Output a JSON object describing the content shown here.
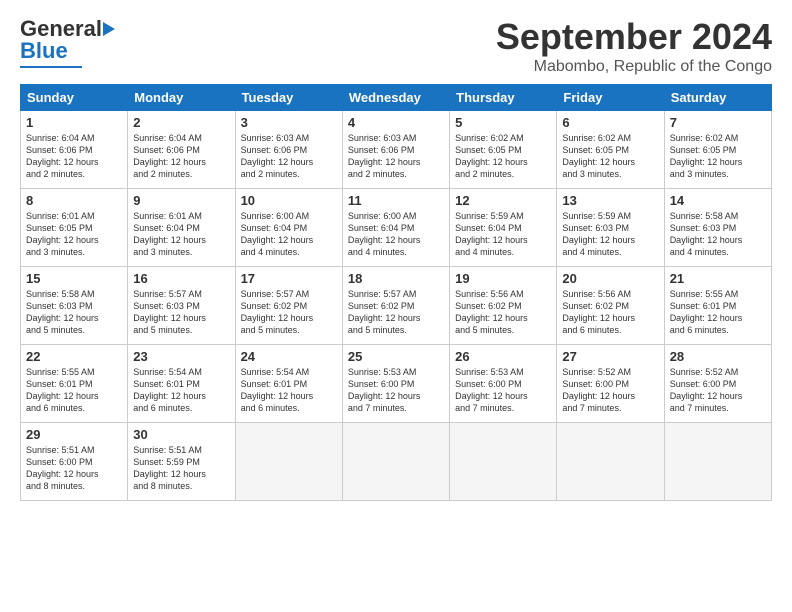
{
  "logo": {
    "text1": "General",
    "text2": "Blue"
  },
  "title": "September 2024",
  "subtitle": "Mabombo, Republic of the Congo",
  "days_of_week": [
    "Sunday",
    "Monday",
    "Tuesday",
    "Wednesday",
    "Thursday",
    "Friday",
    "Saturday"
  ],
  "weeks": [
    [
      {
        "day": "1",
        "info": "Sunrise: 6:04 AM\nSunset: 6:06 PM\nDaylight: 12 hours\nand 2 minutes."
      },
      {
        "day": "2",
        "info": "Sunrise: 6:04 AM\nSunset: 6:06 PM\nDaylight: 12 hours\nand 2 minutes."
      },
      {
        "day": "3",
        "info": "Sunrise: 6:03 AM\nSunset: 6:06 PM\nDaylight: 12 hours\nand 2 minutes."
      },
      {
        "day": "4",
        "info": "Sunrise: 6:03 AM\nSunset: 6:06 PM\nDaylight: 12 hours\nand 2 minutes."
      },
      {
        "day": "5",
        "info": "Sunrise: 6:02 AM\nSunset: 6:05 PM\nDaylight: 12 hours\nand 2 minutes."
      },
      {
        "day": "6",
        "info": "Sunrise: 6:02 AM\nSunset: 6:05 PM\nDaylight: 12 hours\nand 3 minutes."
      },
      {
        "day": "7",
        "info": "Sunrise: 6:02 AM\nSunset: 6:05 PM\nDaylight: 12 hours\nand 3 minutes."
      }
    ],
    [
      {
        "day": "8",
        "info": "Sunrise: 6:01 AM\nSunset: 6:05 PM\nDaylight: 12 hours\nand 3 minutes."
      },
      {
        "day": "9",
        "info": "Sunrise: 6:01 AM\nSunset: 6:04 PM\nDaylight: 12 hours\nand 3 minutes."
      },
      {
        "day": "10",
        "info": "Sunrise: 6:00 AM\nSunset: 6:04 PM\nDaylight: 12 hours\nand 4 minutes."
      },
      {
        "day": "11",
        "info": "Sunrise: 6:00 AM\nSunset: 6:04 PM\nDaylight: 12 hours\nand 4 minutes."
      },
      {
        "day": "12",
        "info": "Sunrise: 5:59 AM\nSunset: 6:04 PM\nDaylight: 12 hours\nand 4 minutes."
      },
      {
        "day": "13",
        "info": "Sunrise: 5:59 AM\nSunset: 6:03 PM\nDaylight: 12 hours\nand 4 minutes."
      },
      {
        "day": "14",
        "info": "Sunrise: 5:58 AM\nSunset: 6:03 PM\nDaylight: 12 hours\nand 4 minutes."
      }
    ],
    [
      {
        "day": "15",
        "info": "Sunrise: 5:58 AM\nSunset: 6:03 PM\nDaylight: 12 hours\nand 5 minutes."
      },
      {
        "day": "16",
        "info": "Sunrise: 5:57 AM\nSunset: 6:03 PM\nDaylight: 12 hours\nand 5 minutes."
      },
      {
        "day": "17",
        "info": "Sunrise: 5:57 AM\nSunset: 6:02 PM\nDaylight: 12 hours\nand 5 minutes."
      },
      {
        "day": "18",
        "info": "Sunrise: 5:57 AM\nSunset: 6:02 PM\nDaylight: 12 hours\nand 5 minutes."
      },
      {
        "day": "19",
        "info": "Sunrise: 5:56 AM\nSunset: 6:02 PM\nDaylight: 12 hours\nand 5 minutes."
      },
      {
        "day": "20",
        "info": "Sunrise: 5:56 AM\nSunset: 6:02 PM\nDaylight: 12 hours\nand 6 minutes."
      },
      {
        "day": "21",
        "info": "Sunrise: 5:55 AM\nSunset: 6:01 PM\nDaylight: 12 hours\nand 6 minutes."
      }
    ],
    [
      {
        "day": "22",
        "info": "Sunrise: 5:55 AM\nSunset: 6:01 PM\nDaylight: 12 hours\nand 6 minutes."
      },
      {
        "day": "23",
        "info": "Sunrise: 5:54 AM\nSunset: 6:01 PM\nDaylight: 12 hours\nand 6 minutes."
      },
      {
        "day": "24",
        "info": "Sunrise: 5:54 AM\nSunset: 6:01 PM\nDaylight: 12 hours\nand 6 minutes."
      },
      {
        "day": "25",
        "info": "Sunrise: 5:53 AM\nSunset: 6:00 PM\nDaylight: 12 hours\nand 7 minutes."
      },
      {
        "day": "26",
        "info": "Sunrise: 5:53 AM\nSunset: 6:00 PM\nDaylight: 12 hours\nand 7 minutes."
      },
      {
        "day": "27",
        "info": "Sunrise: 5:52 AM\nSunset: 6:00 PM\nDaylight: 12 hours\nand 7 minutes."
      },
      {
        "day": "28",
        "info": "Sunrise: 5:52 AM\nSunset: 6:00 PM\nDaylight: 12 hours\nand 7 minutes."
      }
    ],
    [
      {
        "day": "29",
        "info": "Sunrise: 5:51 AM\nSunset: 6:00 PM\nDaylight: 12 hours\nand 8 minutes."
      },
      {
        "day": "30",
        "info": "Sunrise: 5:51 AM\nSunset: 5:59 PM\nDaylight: 12 hours\nand 8 minutes."
      },
      {
        "day": "",
        "info": ""
      },
      {
        "day": "",
        "info": ""
      },
      {
        "day": "",
        "info": ""
      },
      {
        "day": "",
        "info": ""
      },
      {
        "day": "",
        "info": ""
      }
    ]
  ]
}
